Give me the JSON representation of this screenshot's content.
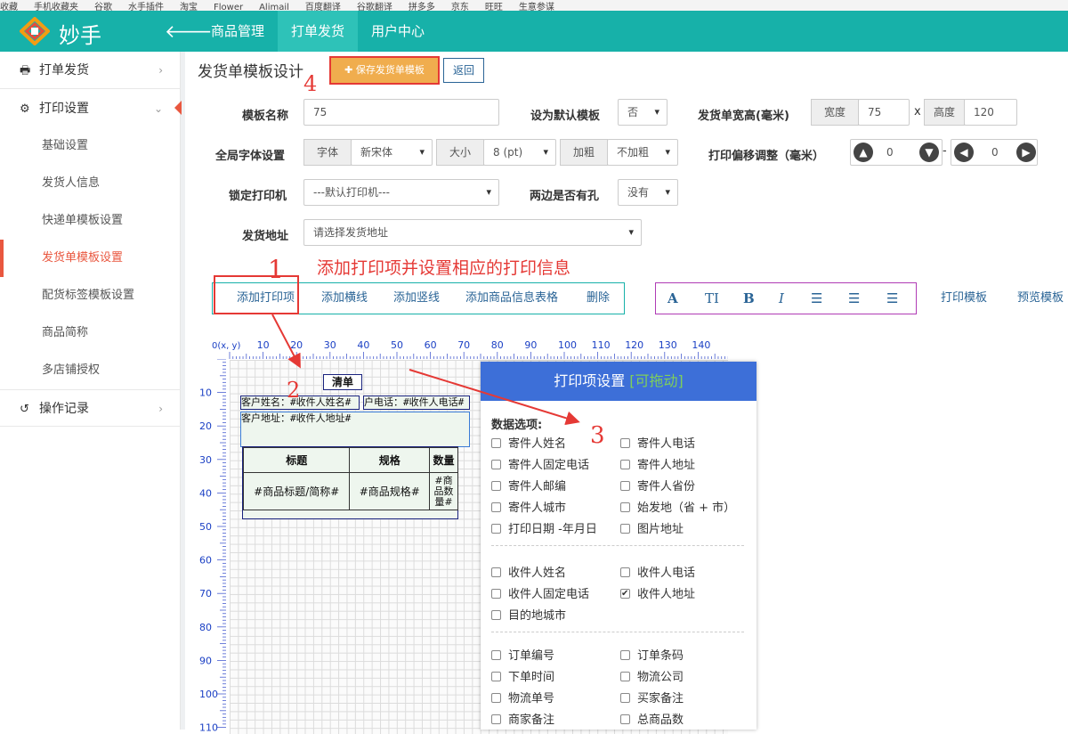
{
  "browser": {
    "bookmarks": [
      "收藏",
      "手机收藏夹",
      "谷歌",
      "水手插件",
      "淘宝",
      "Flower",
      "Alimail",
      "百度翻译",
      "谷歌翻译",
      "拼多多",
      "京东",
      "旺旺",
      "生意参谋"
    ]
  },
  "header": {
    "logo_text": "妙手",
    "nav": [
      "商品管理",
      "打单发货",
      "用户中心"
    ],
    "active_nav": "打单发货"
  },
  "sidebar": {
    "items": [
      {
        "label": "打单发货",
        "icon": "printer-icon",
        "type": "top"
      },
      {
        "label": "打印设置",
        "icon": "gear-icon",
        "type": "top"
      },
      {
        "label": "基础设置",
        "type": "sub"
      },
      {
        "label": "发货人信息",
        "type": "sub"
      },
      {
        "label": "快递单模板设置",
        "type": "sub"
      },
      {
        "label": "发货单模板设置",
        "type": "sub",
        "active": true
      },
      {
        "label": "配货标签模板设置",
        "type": "sub"
      },
      {
        "label": "商品简称",
        "type": "sub"
      },
      {
        "label": "多店铺授权",
        "type": "sub"
      },
      {
        "label": "操作记录",
        "icon": "history-icon",
        "type": "top"
      }
    ]
  },
  "main": {
    "title": "发货单模板设计",
    "save_button": "保存发货单模板",
    "return_button": "返回",
    "form": {
      "template_name_label": "模板名称",
      "template_name_value": "75",
      "default_label": "设为默认模板",
      "default_value": "否",
      "size_label": "发货单宽高(毫米)",
      "width_label": "宽度",
      "width_value": "75",
      "x_sep": "x",
      "height_label": "高度",
      "height_value": "120",
      "font_label": "全局字体设置",
      "font_addon": "字体",
      "font_value": "新宋体",
      "size_addon": "大小",
      "size_value": "8 (pt)",
      "bold_addon": "加粗",
      "bold_value": "不加粗",
      "offset_label": "打印偏移调整（毫米）",
      "offset_y": "0",
      "offset_dash": "-",
      "offset_x": "0",
      "printer_label": "锁定打印机",
      "printer_value": "---默认打印机---",
      "holes_label": "两边是否有孔",
      "holes_value": "没有",
      "address_label": "发货地址",
      "address_placeholder": "请选择发货地址"
    },
    "annotation_main": "添加打印项并设置相应的打印信息",
    "annotation_nums": [
      "1",
      "2",
      "3",
      "4"
    ],
    "toolbar_actions": [
      "添加打印项",
      "添加横线",
      "添加竖线",
      "添加商品信息表格",
      "删除"
    ],
    "format_buttons": [
      "A",
      "TI",
      "B",
      "I"
    ],
    "right_links": [
      "打印模板",
      "预览模板"
    ]
  },
  "canvas": {
    "origin_label": "0(x, y)",
    "ruler_top": [
      "10",
      "20",
      "30",
      "40",
      "50",
      "60",
      "70",
      "80",
      "90",
      "100",
      "110",
      "120",
      "130",
      "140"
    ],
    "ruler_left": [
      "10",
      "20",
      "30",
      "40",
      "50",
      "60",
      "70",
      "80",
      "90",
      "100",
      "110"
    ],
    "title_item": "清单",
    "name_item": "客户姓名：#收件人姓名#",
    "phone_item": "户电话：#收件人电话#",
    "address_item": "客户地址：#收件人地址#",
    "table_headers": [
      "标题",
      "规格",
      "数量"
    ],
    "table_row": [
      "#商品标题/简称#",
      "#商品规格#",
      "#商品数量#"
    ]
  },
  "panel": {
    "title": "打印项设置",
    "draggable_hint": "[可拖动]",
    "section_label": "数据选项:",
    "groups": [
      [
        {
          "label": "寄件人姓名",
          "checked": false
        },
        {
          "label": "寄件人电话",
          "checked": false
        },
        {
          "label": "寄件人固定电话",
          "checked": false
        },
        {
          "label": "寄件人地址",
          "checked": false
        },
        {
          "label": "寄件人邮编",
          "checked": false
        },
        {
          "label": "寄件人省份",
          "checked": false
        },
        {
          "label": "寄件人城市",
          "checked": false
        },
        {
          "label": "始发地（省 + 市）",
          "checked": false
        },
        {
          "label": "打印日期 -年月日",
          "checked": false
        },
        {
          "label": "图片地址",
          "checked": false
        }
      ],
      [
        {
          "label": "收件人姓名",
          "checked": false
        },
        {
          "label": "收件人电话",
          "checked": false
        },
        {
          "label": "收件人固定电话",
          "checked": false
        },
        {
          "label": "收件人地址",
          "checked": true
        },
        {
          "label": "目的地城市",
          "checked": false
        }
      ],
      [
        {
          "label": "订单编号",
          "checked": false
        },
        {
          "label": "订单条码",
          "checked": false
        },
        {
          "label": "下单时间",
          "checked": false
        },
        {
          "label": "物流公司",
          "checked": false
        },
        {
          "label": "物流单号",
          "checked": false
        },
        {
          "label": "买家备注",
          "checked": false
        },
        {
          "label": "商家备注",
          "checked": false
        },
        {
          "label": "总商品数",
          "checked": false
        }
      ]
    ]
  },
  "colors": {
    "topbar": "#17b1a9",
    "accent_red": "#e53935",
    "save_orange": "#f0ad4e",
    "panel_blue": "#3d6fd8",
    "link_blue": "#2a6496"
  }
}
